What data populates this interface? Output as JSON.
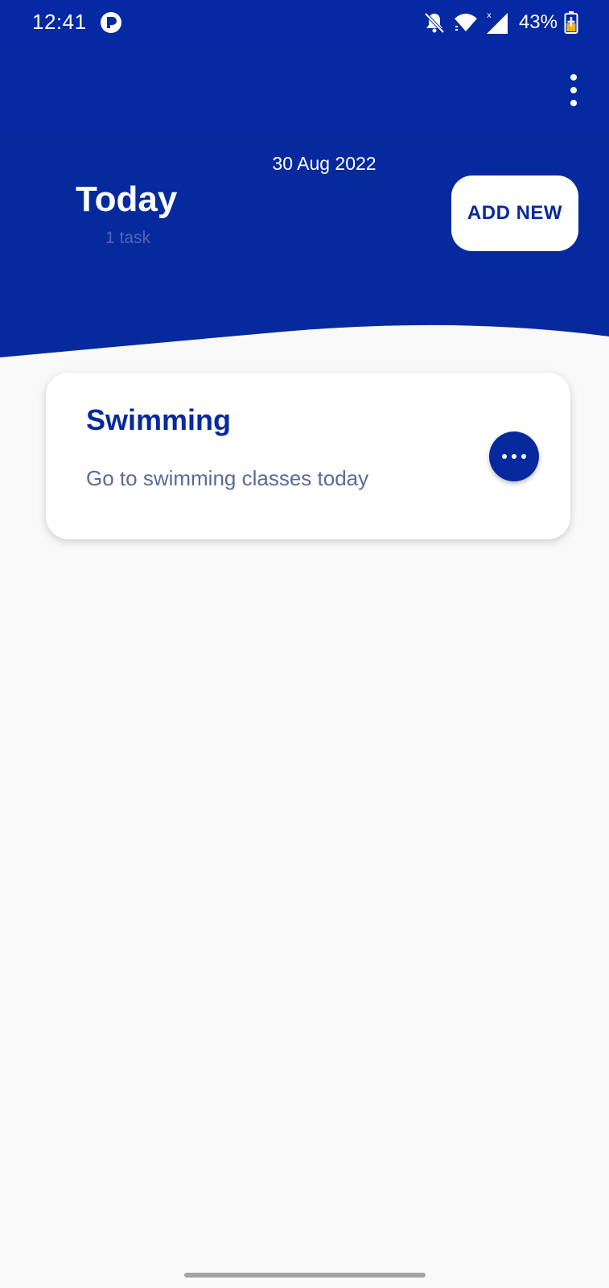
{
  "colors": {
    "primary": "#062a9e",
    "status_bar_bg": "#0528a3",
    "background": "#f9f9f9",
    "card_bg": "#ffffff",
    "muted_text": "#5a6b9c"
  },
  "status_bar": {
    "time": "12:41",
    "battery_percent": "43%",
    "icons": [
      "app-notification-icon",
      "bell-off-icon",
      "wifi-icon",
      "cellular-signal-icon",
      "battery-charging-icon"
    ]
  },
  "header": {
    "menu_icon": "more-vert-icon",
    "date": "30 Aug 2022",
    "title": "Today",
    "task_count": "1 task",
    "add_button_label": "ADD NEW"
  },
  "tasks": [
    {
      "title": "Swimming",
      "description": "Go to swimming classes today",
      "menu_icon": "more-horiz-icon"
    }
  ]
}
